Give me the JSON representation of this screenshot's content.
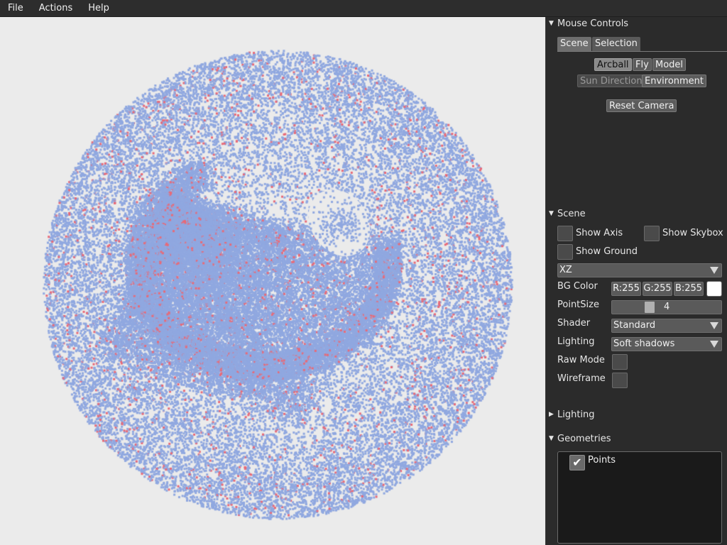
{
  "menu": {
    "items": [
      "File",
      "Actions",
      "Help"
    ]
  },
  "mouse_controls": {
    "title": "Mouse Controls",
    "tabs": [
      "Scene",
      "Selection"
    ],
    "buttons": {
      "arcball": "Arcball",
      "fly": "Fly",
      "model": "Model",
      "sun_direction": "Sun Direction",
      "environment": "Environment",
      "reset_camera": "Reset Camera"
    }
  },
  "scene": {
    "title": "Scene",
    "show_axis": "Show Axis",
    "show_skybox": "Show Skybox",
    "show_ground": "Show Ground",
    "ground_plane": "XZ",
    "bg_color_label": "BG Color",
    "bg_r": "R:255",
    "bg_g": "G:255",
    "bg_b": "B:255",
    "bg_swatch_color": "#ffffff",
    "point_size_label": "PointSize",
    "point_size_value": "4",
    "shader_label": "Shader",
    "shader_value": "Standard",
    "lighting_label": "Lighting",
    "lighting_value": "Soft shadows",
    "raw_mode_label": "Raw Mode",
    "wireframe_label": "Wireframe"
  },
  "lighting_section": {
    "title": "Lighting"
  },
  "geometries": {
    "title": "Geometries",
    "items": [
      {
        "label": "Points",
        "checked": true
      }
    ]
  },
  "colors": {
    "viewport_bg": "#ebebeb",
    "point_blue": "#90a8e0",
    "point_red": "#e86a78",
    "panel_bg": "#2b2b2b"
  }
}
